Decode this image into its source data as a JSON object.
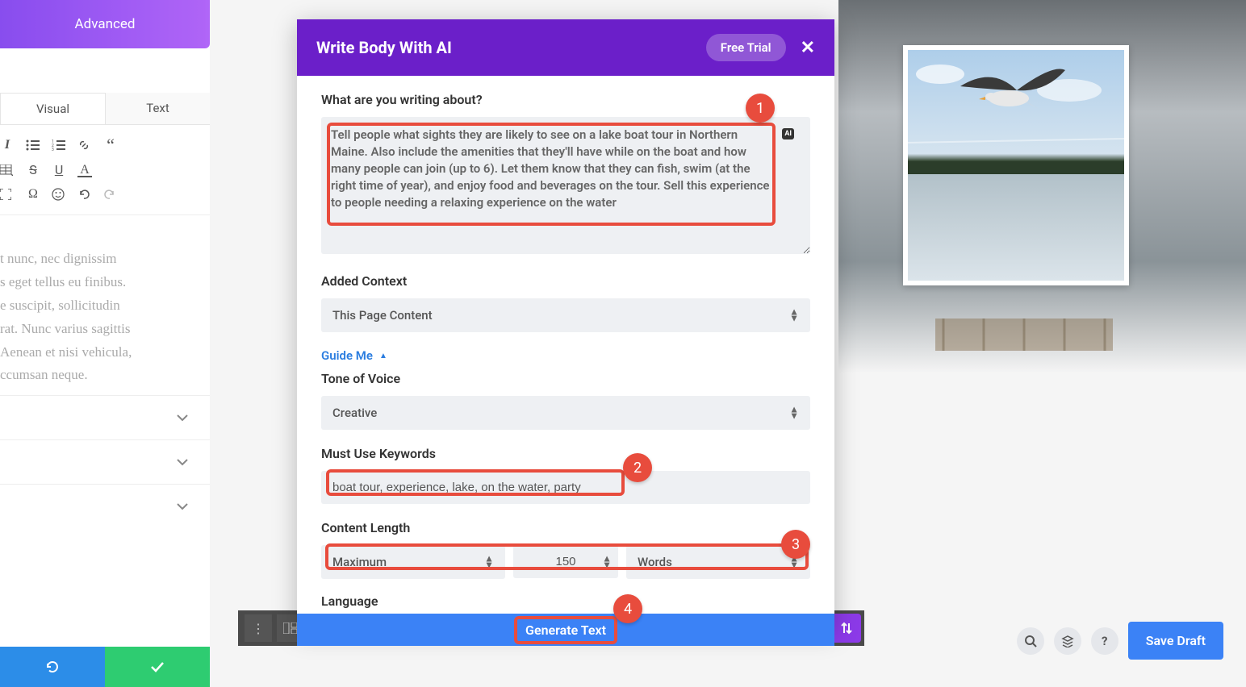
{
  "left": {
    "advanced_tab": "Advanced",
    "editor_tabs": {
      "visual": "Visual",
      "text": "Text"
    },
    "body_sample": "t nunc, nec dignissim\ns eget tellus eu finibus.\ne suscipit, sollicitudin\nrat. Nunc varius sagittis\nAenean et nisi vehicula,\nccumsan neque."
  },
  "modal": {
    "title": "Write Body With AI",
    "free_trial": "Free Trial",
    "prompt_label": "What are you writing about?",
    "prompt_value": "Tell people what sights they are likely to see on a lake boat tour in Northern Maine. Also include the amenities that they'll have while on the boat and how many people can join (up to 6). Let them know that they can fish, swim (at the right time of year), and enjoy food and beverages on the tour. Sell this experience to people needing a relaxing experience on the water",
    "ai_badge": "AI",
    "context_label": "Added Context",
    "context_value": "This Page Content",
    "guide_me": "Guide Me",
    "tone_label": "Tone of Voice",
    "tone_value": "Creative",
    "keywords_label": "Must Use Keywords",
    "keywords_value": "boat tour, experience, lake, on the water, party",
    "length_label": "Content Length",
    "length_mode": "Maximum",
    "length_value": "150",
    "length_unit": "Words",
    "language_label": "Language",
    "generate": "Generate Text"
  },
  "annotations": {
    "a1": "1",
    "a2": "2",
    "a3": "3",
    "a4": "4"
  },
  "footer": {
    "save_draft": "Save Draft"
  }
}
